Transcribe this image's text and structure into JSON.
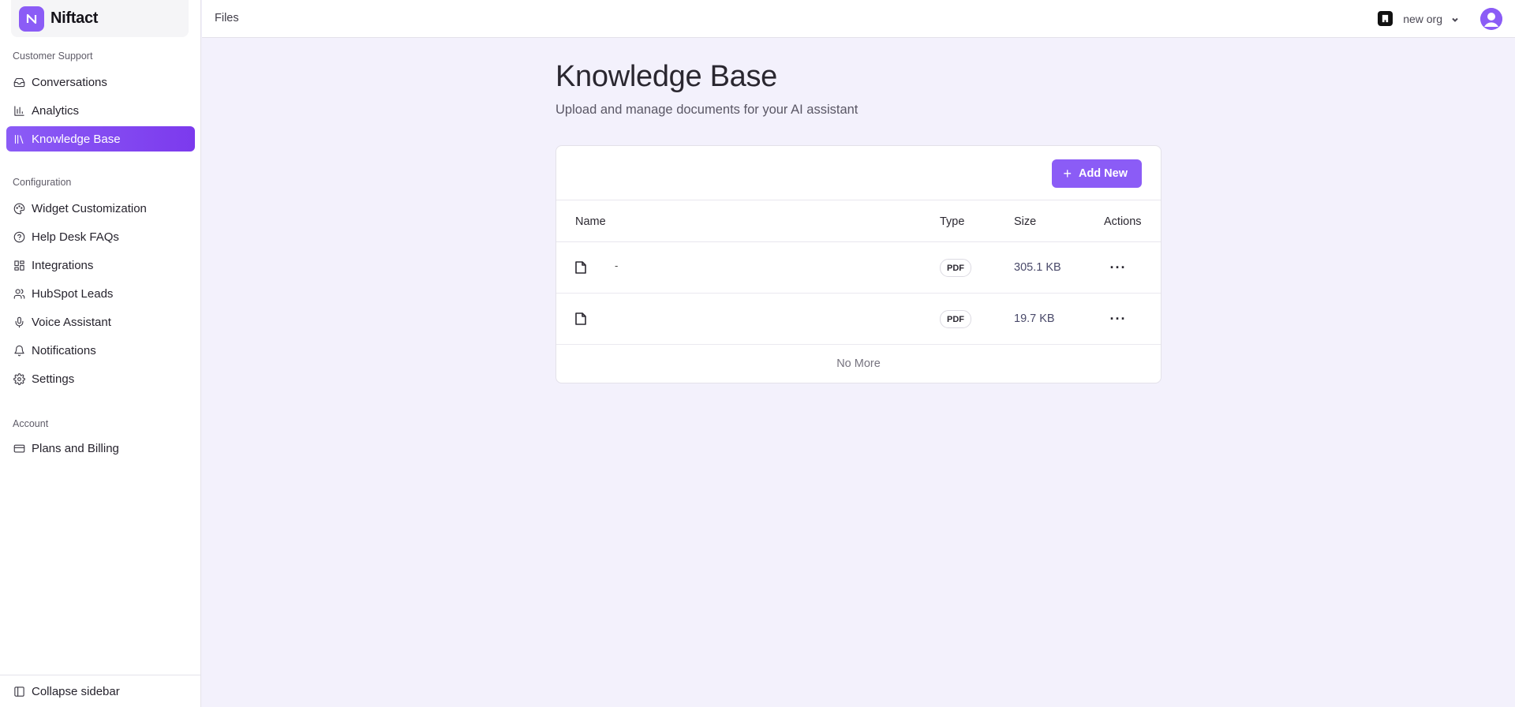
{
  "brand": {
    "logo_text": "N",
    "name": "Niftact"
  },
  "sidebar": {
    "sections": [
      {
        "label": "Customer Support"
      },
      {
        "label": "Configuration"
      },
      {
        "label": "Account"
      }
    ],
    "items": [
      {
        "label": "Conversations",
        "icon": "inbox-icon"
      },
      {
        "label": "Analytics",
        "icon": "bar-chart-icon"
      },
      {
        "label": "Knowledge Base",
        "icon": "library-icon",
        "active": true
      },
      {
        "label": "Widget Customization",
        "icon": "palette-icon"
      },
      {
        "label": "Help Desk FAQs",
        "icon": "help-circle-icon"
      },
      {
        "label": "Integrations",
        "icon": "grid-icon"
      },
      {
        "label": "HubSpot Leads",
        "icon": "users-icon"
      },
      {
        "label": "Voice Assistant",
        "icon": "mic-icon"
      },
      {
        "label": "Notifications",
        "icon": "bell-icon"
      },
      {
        "label": "Settings",
        "icon": "gear-icon"
      },
      {
        "label": "Plans and Billing",
        "icon": "credit-card-icon"
      }
    ],
    "collapse_label": "Collapse sidebar"
  },
  "topbar": {
    "breadcrumb": "Files",
    "org_name": "new org"
  },
  "main": {
    "title": "Knowledge Base",
    "subtitle": "Upload and manage documents for your AI assistant",
    "add_button": "Add New",
    "table": {
      "columns": [
        "Name",
        "Type",
        "Size",
        "Actions"
      ],
      "rows": [
        {
          "name": "-",
          "type": "PDF",
          "size": "305.1 KB"
        },
        {
          "name": "",
          "type": "PDF",
          "size": "19.7 KB"
        }
      ],
      "footer": "No More"
    }
  },
  "colors": {
    "accent": "#8b5cf6",
    "background": "#f3f1fc"
  }
}
